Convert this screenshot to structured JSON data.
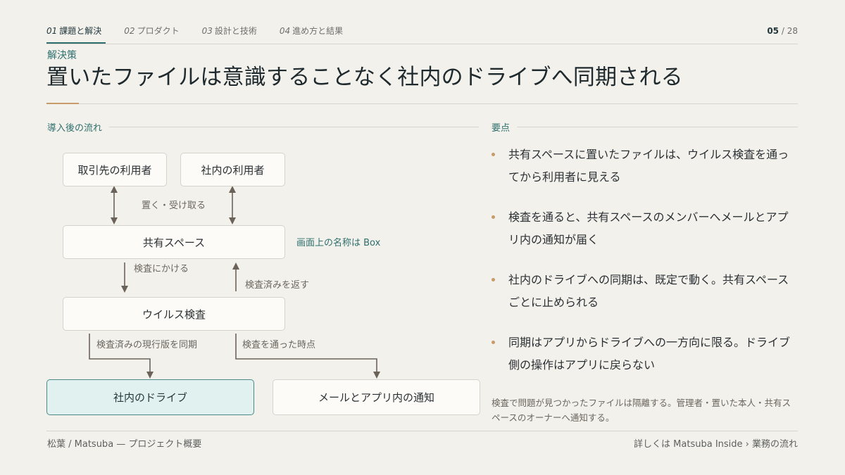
{
  "nav": {
    "tabs": [
      {
        "num": "01",
        "label": "課題と解決"
      },
      {
        "num": "02",
        "label": "プロダクト"
      },
      {
        "num": "03",
        "label": "設計と技術"
      },
      {
        "num": "04",
        "label": "進め方と結果"
      }
    ],
    "active_index": 0,
    "page_current": "05",
    "page_sep": "/",
    "page_total": "28"
  },
  "header": {
    "kicker": "解決策",
    "title": "置いたファイルは意識することなく社内のドライブへ同期される"
  },
  "flow": {
    "section_label": "導入後の流れ",
    "nodes": {
      "partner_users": "取引先の利用者",
      "internal_users": "社内の利用者",
      "shared_space": "共有スペース",
      "virus_scan": "ウイルス検査",
      "internal_drive": "社内のドライブ",
      "notifications": "メールとアプリ内の通知"
    },
    "edge_labels": {
      "put_receive": "置く・受け取る",
      "send_to_scan": "検査にかける",
      "return_scanned": "検査済みを返す",
      "sync_current": "検査済みの現行版を同期",
      "on_pass": "検査を通った時点"
    },
    "shared_space_note": "画面上の名称は Box"
  },
  "points": {
    "section_label": "要点",
    "items": [
      "共有スペースに置いたファイルは、ウイルス検査を通ってから利用者に見える",
      "検査を通ると、共有スペースのメンバーへメールとアプリ内の通知が届く",
      "社内のドライブへの同期は、既定で動く。共有スペースごとに止められる",
      "同期はアプリからドライブへの一方向に限る。ドライブ側の操作はアプリに戻らない"
    ],
    "footnote": "検査で問題が見つかったファイルは隔離する。管理者・置いた本人・共有スペースのオーナーへ通知する。"
  },
  "footer": {
    "left": "松葉 / Matsuba — プロジェクト概要",
    "right": "詳しくは Matsuba Inside › 業務の流れ"
  },
  "colors": {
    "accent_teal": "#2e6f6d",
    "accent_gold": "#c89b6a",
    "highlight_fill": "#e1f1f0",
    "arrow": "#6b635a"
  }
}
